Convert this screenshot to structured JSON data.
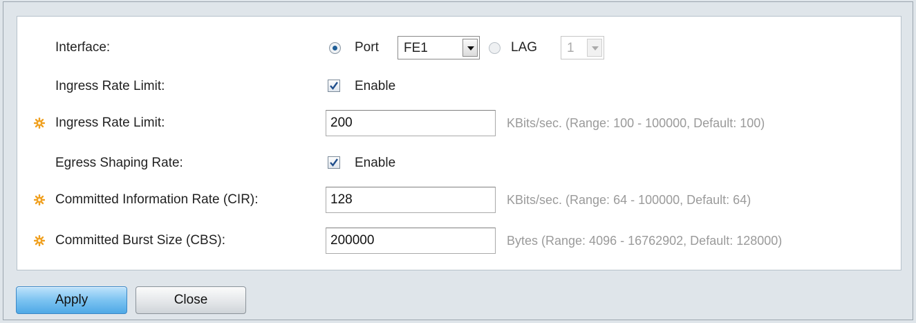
{
  "form": {
    "interface": {
      "label": "Interface:",
      "port_label": "Port",
      "port_value": "FE1",
      "lag_label": "LAG",
      "lag_value": "1"
    },
    "ingress_enable": {
      "label": "Ingress Rate Limit:",
      "checkbox_label": "Enable",
      "checked": true
    },
    "ingress_rate": {
      "label": "Ingress Rate Limit:",
      "value": "200",
      "hint": "KBits/sec. (Range: 100 - 100000, Default: 100)"
    },
    "egress_enable": {
      "label": "Egress Shaping Rate:",
      "checkbox_label": "Enable",
      "checked": true
    },
    "cir": {
      "label": "Committed Information Rate (CIR):",
      "value": "128",
      "hint": "KBits/sec. (Range: 64 - 100000, Default: 64)"
    },
    "cbs": {
      "label": "Committed Burst Size (CBS):",
      "value": "200000",
      "hint": "Bytes (Range: 4096 - 16762902, Default: 128000)"
    }
  },
  "buttons": {
    "apply": "Apply",
    "close": "Close"
  },
  "icons": {
    "required": "required-star-icon"
  },
  "colors": {
    "required_star": "#f0a020",
    "apply_button": "#6bbbee",
    "checkmark": "#1f4e8c"
  }
}
